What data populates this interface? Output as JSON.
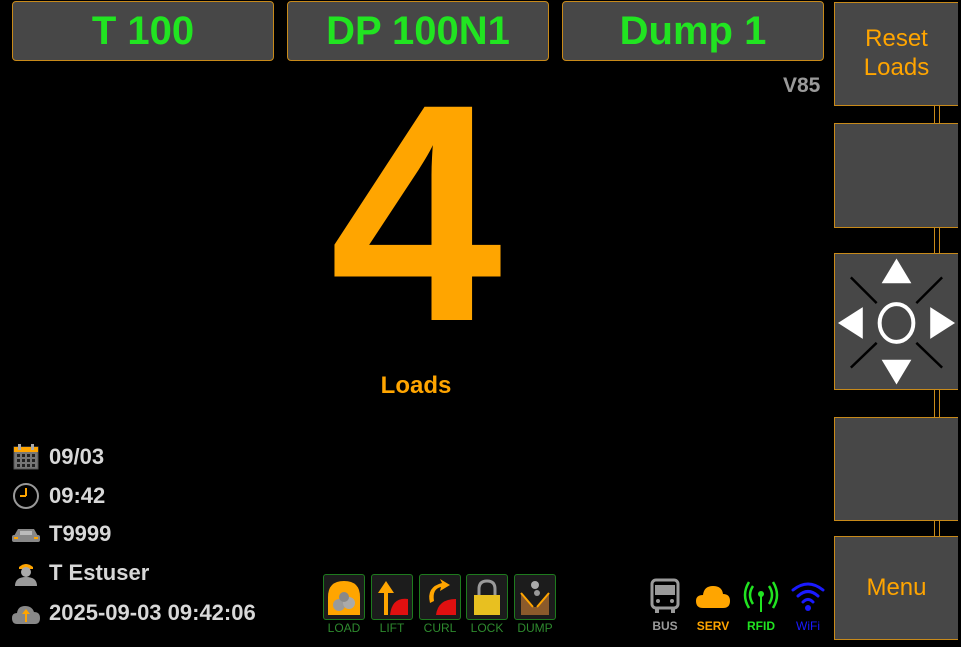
{
  "header": {
    "truck_button": "T 100",
    "loader_button": "DP 100N1",
    "dump_button": "Dump 1"
  },
  "version": "V85",
  "main": {
    "count": "4",
    "count_label": "Loads"
  },
  "info": {
    "date": "09/03",
    "time": "09:42",
    "vehicle": "T9999",
    "operator": "T Estuser",
    "last_sync": "2025-09-03 09:42:06"
  },
  "sidebar": {
    "reset_label": "Reset Loads",
    "menu_label": "Menu"
  },
  "modes": [
    {
      "label": "LOAD",
      "icon": "load-icon"
    },
    {
      "label": "LIFT",
      "icon": "lift-icon"
    },
    {
      "label": "CURL",
      "icon": "curl-icon"
    },
    {
      "label": "LOCK",
      "icon": "lock-icon"
    },
    {
      "label": "DUMP",
      "icon": "dump-icon"
    }
  ],
  "status": [
    {
      "label": "BUS",
      "icon": "bus-icon",
      "color": "#9a9a9a"
    },
    {
      "label": "SERV",
      "icon": "cloud-icon",
      "color": "#ffa500"
    },
    {
      "label": "RFID",
      "icon": "rfid-icon",
      "color": "#21e421"
    },
    {
      "label": "WiFi",
      "icon": "wifi-icon",
      "color": "#1a1aff"
    }
  ],
  "colors": {
    "accent": "#ffa500",
    "top_text": "#21e421",
    "button_bg": "#474747",
    "border": "#c88a1a"
  }
}
